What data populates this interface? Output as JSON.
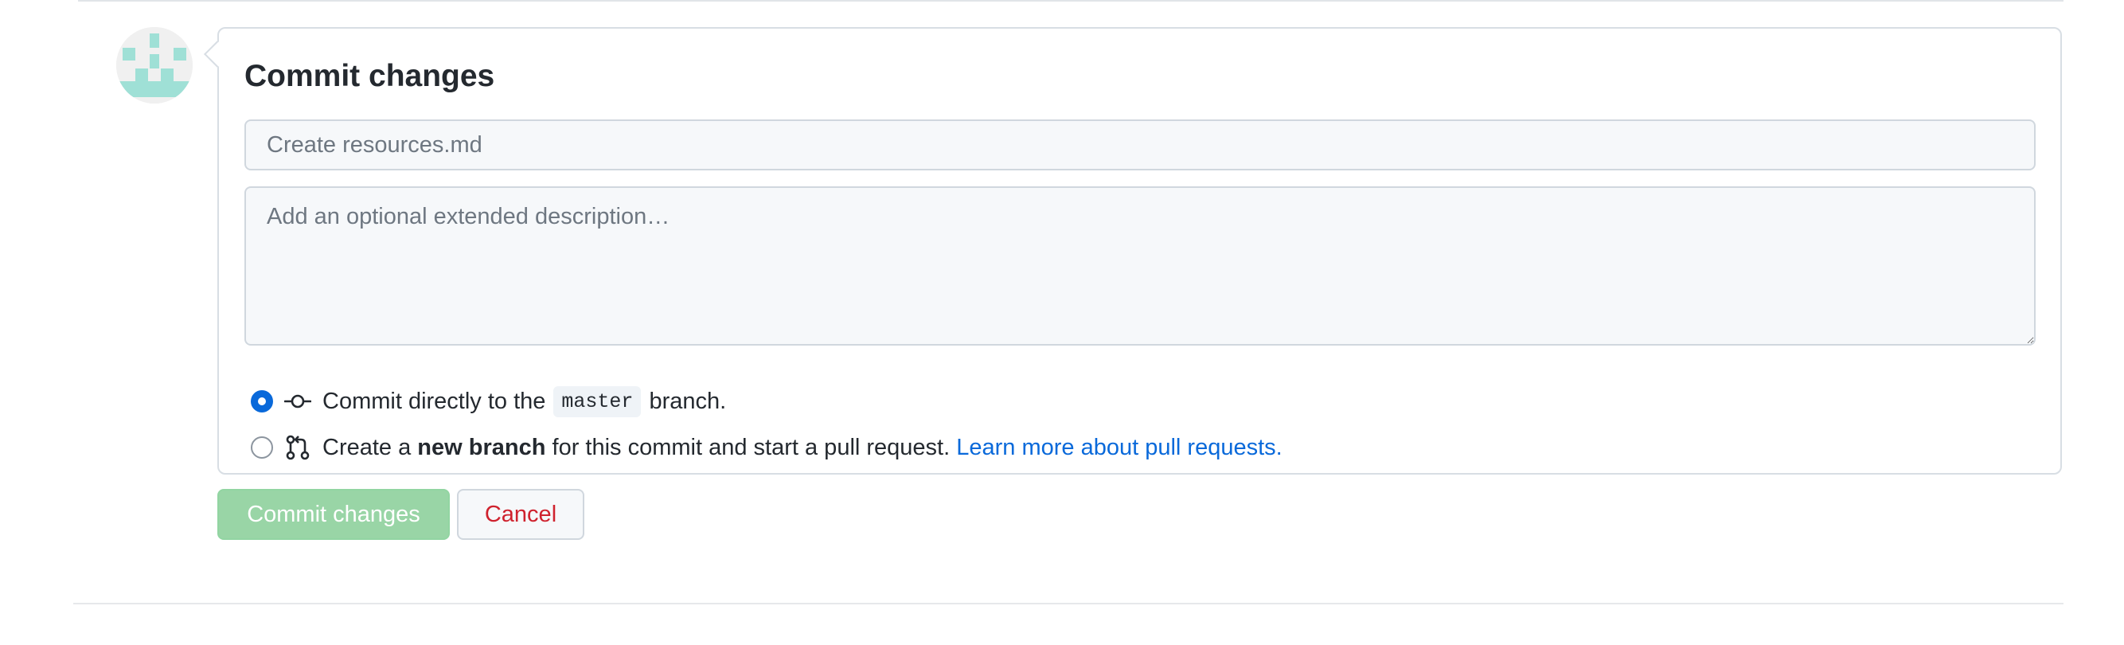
{
  "commit_form": {
    "title": "Commit changes",
    "summary_placeholder": "Create resources.md",
    "summary_value": "",
    "description_placeholder": "Add an optional extended description…",
    "description_value": "",
    "options": [
      {
        "selected": true,
        "icon": "git-commit-icon",
        "text_before": "Commit directly to the",
        "branch": "master",
        "text_after": "branch."
      },
      {
        "selected": false,
        "icon": "git-pull-request-icon",
        "text_before": "Create a",
        "strong": "new branch",
        "text_after": "for this commit and start a pull request.",
        "link": "Learn more about pull requests."
      }
    ]
  },
  "actions": {
    "commit_label": "Commit changes",
    "cancel_label": "Cancel"
  },
  "colors": {
    "accent": "#0969da",
    "commit_button_disabled": "#94d3a2",
    "cancel_text": "#cf222e",
    "avatar_identicon": "#9fe0d6"
  }
}
